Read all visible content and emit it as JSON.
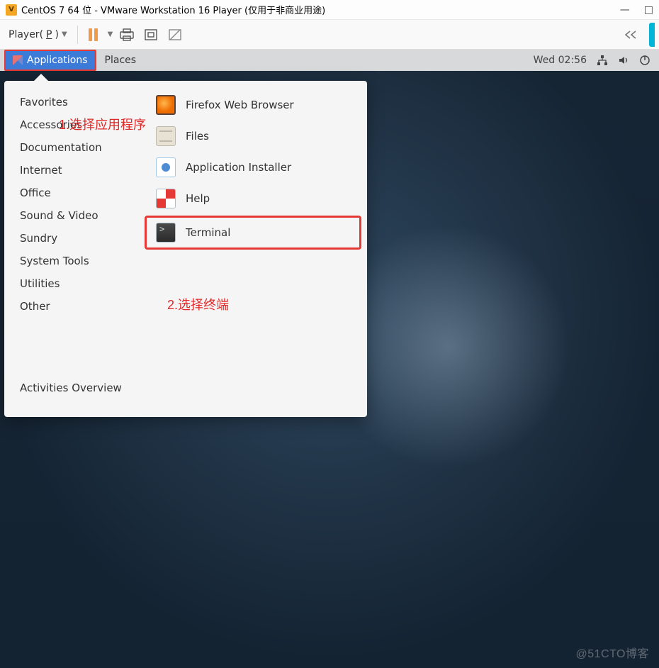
{
  "window": {
    "title": "CentOS 7 64 位 - VMware Workstation 16 Player (仅用于非商业用途)"
  },
  "host_toolbar": {
    "player_label_pre": "Player(",
    "player_mnemonic": "P",
    "player_label_post": ")"
  },
  "gnome": {
    "applications": "Applications",
    "places": "Places",
    "clock": "Wed 02:56"
  },
  "menu": {
    "categories": [
      "Favorites",
      "Accessories",
      "Documentation",
      "Internet",
      "Office",
      "Sound & Video",
      "Sundry",
      "System Tools",
      "Utilities",
      "Other"
    ],
    "activities": "Activities Overview",
    "apps": {
      "firefox": "Firefox Web Browser",
      "files": "Files",
      "install": "Application Installer",
      "help": "Help",
      "terminal": "Terminal"
    }
  },
  "annotations": {
    "step1": "1.选择应用程序",
    "step2": "2.选择终端"
  },
  "watermark": "@51CTO博客"
}
